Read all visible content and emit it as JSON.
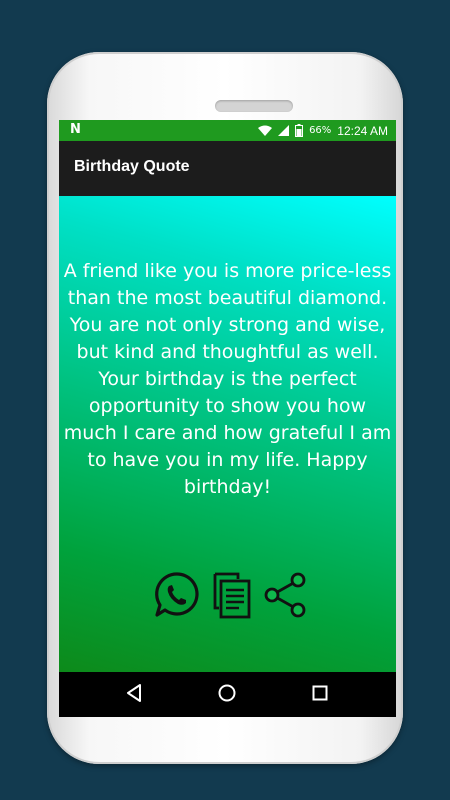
{
  "status_bar": {
    "notification_icon": "N",
    "battery_percent": "66%",
    "time": "12:24 AM",
    "icons": [
      "wifi-icon",
      "signal-icon",
      "battery-icon"
    ],
    "background": "#1f9a1f"
  },
  "app_bar": {
    "title": "Birthday Quote",
    "background": "#1c1c1c"
  },
  "quote": {
    "text": "A friend like you is more price-less than the most beautiful diamond. You are not only strong and wise, but kind and thoughtful as well. Your birthday is the perfect opportunity to show you how much I care and how grateful I am to have you in my life. Happy birthday!"
  },
  "actions": [
    {
      "name": "whatsapp-button",
      "icon": "whatsapp-icon"
    },
    {
      "name": "copy-button",
      "icon": "copy-icon"
    },
    {
      "name": "share-button",
      "icon": "share-icon"
    }
  ],
  "navigation": [
    "back-icon",
    "home-icon",
    "recents-icon"
  ],
  "colors": {
    "gradient_top": "#00ffff",
    "gradient_bottom": "#0d8a1a",
    "page_background": "#123a4f"
  }
}
